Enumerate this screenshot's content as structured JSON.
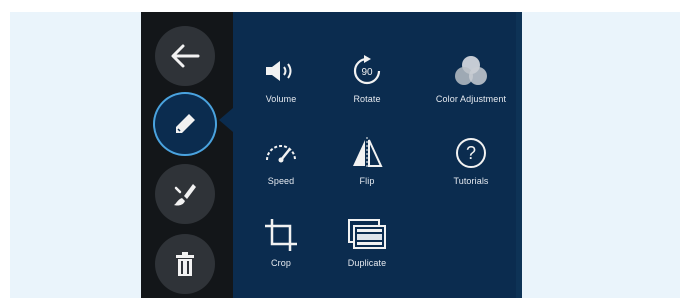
{
  "menu": {
    "back_icon": "arrow-left-icon",
    "edit_icon": "pencil-icon",
    "effects_icon": "brush-icon",
    "delete_icon": "trash-icon"
  },
  "tools": [
    {
      "label": "Volume",
      "icon": "volume-icon"
    },
    {
      "label": "Rotate",
      "icon": "rotate-90-icon",
      "badge": "90"
    },
    {
      "label": "Color Adjustment",
      "icon": "color-circles-icon"
    },
    {
      "label": "Speed",
      "icon": "speedometer-icon"
    },
    {
      "label": "Flip",
      "icon": "flip-icon"
    },
    {
      "label": "Tutorials",
      "icon": "question-icon",
      "badge": "?"
    },
    {
      "label": "Crop",
      "icon": "crop-icon"
    },
    {
      "label": "Duplicate",
      "icon": "duplicate-icon"
    }
  ],
  "colors": {
    "panel_bg": "#0b2c4f",
    "rail_bg": "#131619",
    "accent": "#4aa3df"
  }
}
